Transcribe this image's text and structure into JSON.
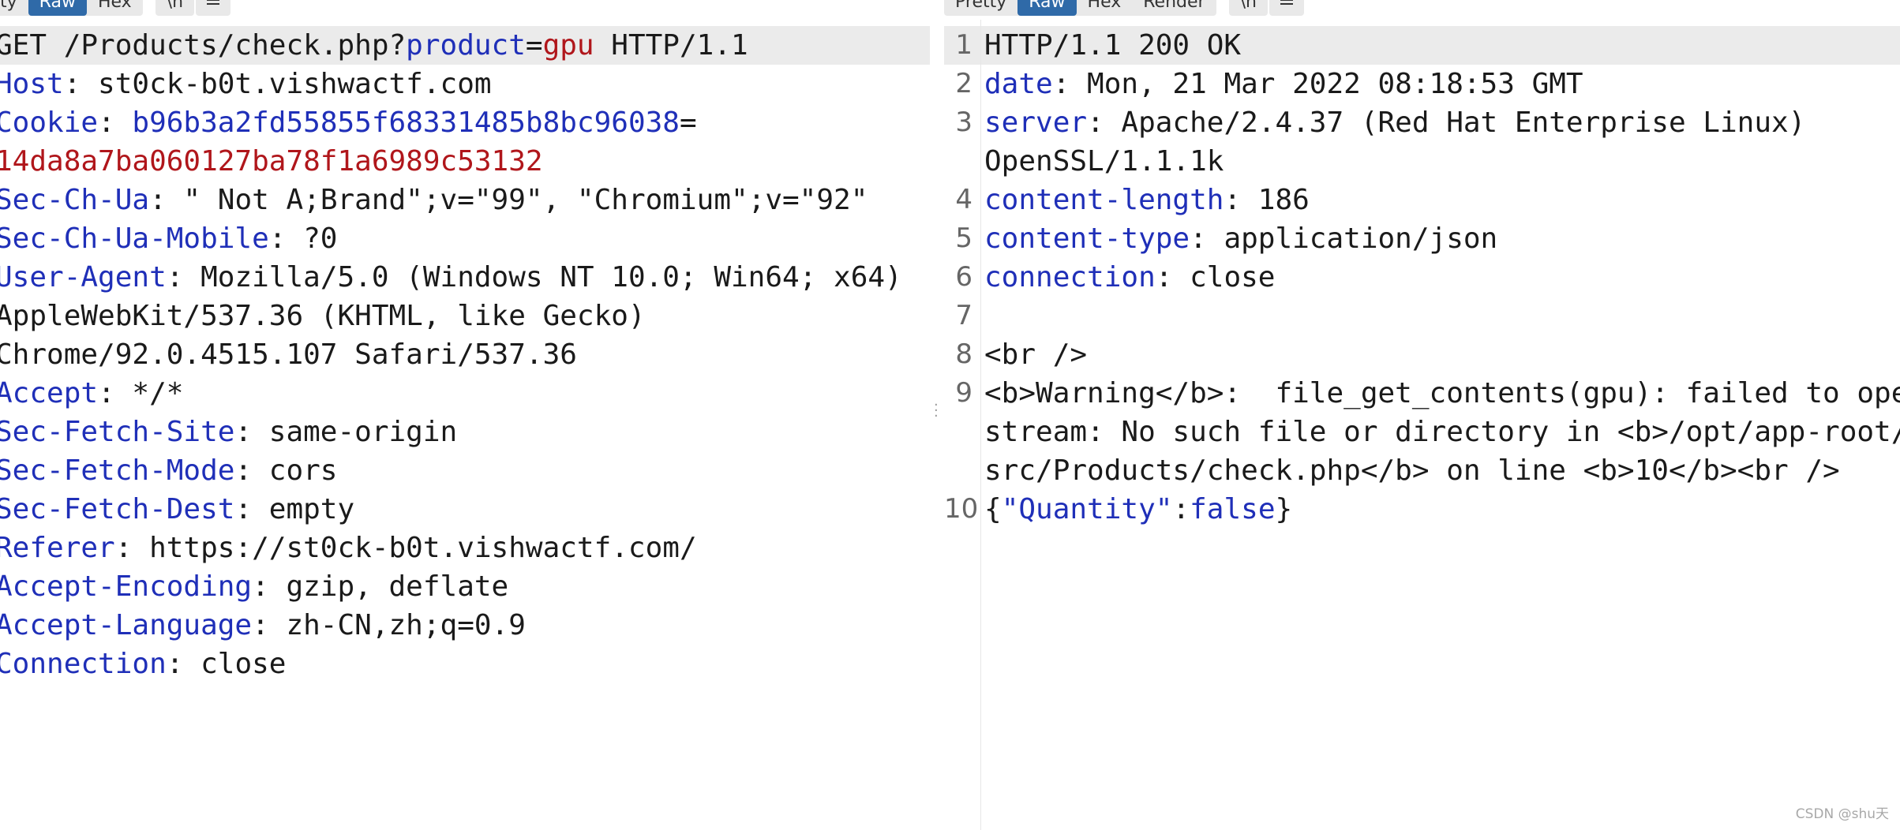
{
  "request": {
    "toolbar": [
      "ty",
      "Raw",
      "Hex",
      "\\n"
    ],
    "lines": [
      [
        {
          "t": "GET /Products/check.php?",
          "c": "v"
        },
        {
          "t": "product",
          "c": "k"
        },
        {
          "t": "=",
          "c": "v"
        },
        {
          "t": "gpu",
          "c": "r"
        },
        {
          "t": " HTTP/1.1",
          "c": "v"
        }
      ],
      [
        {
          "t": "Host",
          "c": "k"
        },
        {
          "t": ": st0ck-b0t.vishwactf.com",
          "c": "v"
        }
      ],
      [
        {
          "t": "Cookie",
          "c": "k"
        },
        {
          "t": ": ",
          "c": "v"
        },
        {
          "t": "b96b3a2fd55855f68331485b8bc96038",
          "c": "k"
        },
        {
          "t": "=",
          "c": "v"
        }
      ],
      [
        {
          "t": "14da8a7ba060127ba78f1a6989c53132",
          "c": "r"
        }
      ],
      [
        {
          "t": "Sec-Ch-Ua",
          "c": "k"
        },
        {
          "t": ": \" Not A;Brand\";v=\"99\", \"Chromium\";v=\"92\"",
          "c": "v"
        }
      ],
      [
        {
          "t": "Sec-Ch-Ua-Mobile",
          "c": "k"
        },
        {
          "t": ": ?0",
          "c": "v"
        }
      ],
      [
        {
          "t": "User-Agent",
          "c": "k"
        },
        {
          "t": ": Mozilla/5.0 (Windows NT 10.0; Win64; x64)",
          "c": "v"
        }
      ],
      [
        {
          "t": "AppleWebKit/537.36 (KHTML, like Gecko)",
          "c": "v"
        }
      ],
      [
        {
          "t": "Chrome/92.0.4515.107 Safari/537.36",
          "c": "v"
        }
      ],
      [
        {
          "t": "Accept",
          "c": "k"
        },
        {
          "t": ": */*",
          "c": "v"
        }
      ],
      [
        {
          "t": "Sec-Fetch-Site",
          "c": "k"
        },
        {
          "t": ": same-origin",
          "c": "v"
        }
      ],
      [
        {
          "t": "Sec-Fetch-Mode",
          "c": "k"
        },
        {
          "t": ": cors",
          "c": "v"
        }
      ],
      [
        {
          "t": "Sec-Fetch-Dest",
          "c": "k"
        },
        {
          "t": ": empty",
          "c": "v"
        }
      ],
      [
        {
          "t": "Referer",
          "c": "k"
        },
        {
          "t": ": https://st0ck-b0t.vishwactf.com/",
          "c": "v"
        }
      ],
      [
        {
          "t": "Accept-Encoding",
          "c": "k"
        },
        {
          "t": ": gzip, deflate",
          "c": "v"
        }
      ],
      [
        {
          "t": "Accept-Language",
          "c": "k"
        },
        {
          "t": ": zh-CN,zh;q=0.9",
          "c": "v"
        }
      ],
      [
        {
          "t": "Connection",
          "c": "k"
        },
        {
          "t": ": close",
          "c": "v"
        }
      ]
    ]
  },
  "response": {
    "toolbar": [
      "Pretty",
      "Raw",
      "Hex",
      "Render",
      "\\n"
    ],
    "lines": [
      {
        "n": "1",
        "segs": [
          {
            "t": "HTTP/1.1 200 OK",
            "c": "v"
          }
        ]
      },
      {
        "n": "2",
        "segs": [
          {
            "t": "date",
            "c": "k"
          },
          {
            "t": ": Mon, 21 Mar 2022 08:18:53 GMT",
            "c": "v"
          }
        ]
      },
      {
        "n": "3",
        "segs": [
          {
            "t": "server",
            "c": "k"
          },
          {
            "t": ": Apache/2.4.37 (Red Hat Enterprise Linux)",
            "c": "v"
          }
        ]
      },
      {
        "n": "",
        "segs": [
          {
            "t": "OpenSSL/1.1.1k",
            "c": "v"
          }
        ]
      },
      {
        "n": "4",
        "segs": [
          {
            "t": "content-length",
            "c": "k"
          },
          {
            "t": ": 186",
            "c": "v"
          }
        ]
      },
      {
        "n": "5",
        "segs": [
          {
            "t": "content-type",
            "c": "k"
          },
          {
            "t": ": application/json",
            "c": "v"
          }
        ]
      },
      {
        "n": "6",
        "segs": [
          {
            "t": "connection",
            "c": "k"
          },
          {
            "t": ": close",
            "c": "v"
          }
        ]
      },
      {
        "n": "7",
        "segs": []
      },
      {
        "n": "8",
        "segs": [
          {
            "t": "<br />",
            "c": "v"
          }
        ]
      },
      {
        "n": "9",
        "segs": [
          {
            "t": "<b>Warning</b>:  file_get_contents(gpu): failed to open",
            "c": "v"
          }
        ]
      },
      {
        "n": "",
        "segs": [
          {
            "t": "stream: No such file or directory in <b>/opt/app-root/",
            "c": "v"
          }
        ]
      },
      {
        "n": "",
        "segs": [
          {
            "t": "src/Products/check.php</b> on line <b>10</b><br />",
            "c": "v"
          }
        ]
      },
      {
        "n": "10",
        "segs": [
          {
            "t": "{",
            "c": "v"
          },
          {
            "t": "\"Quantity\"",
            "c": "k"
          },
          {
            "t": ":",
            "c": "v"
          },
          {
            "t": "false",
            "c": "k"
          },
          {
            "t": "}",
            "c": "v"
          }
        ]
      }
    ]
  },
  "watermark": "CSDN @shu天"
}
